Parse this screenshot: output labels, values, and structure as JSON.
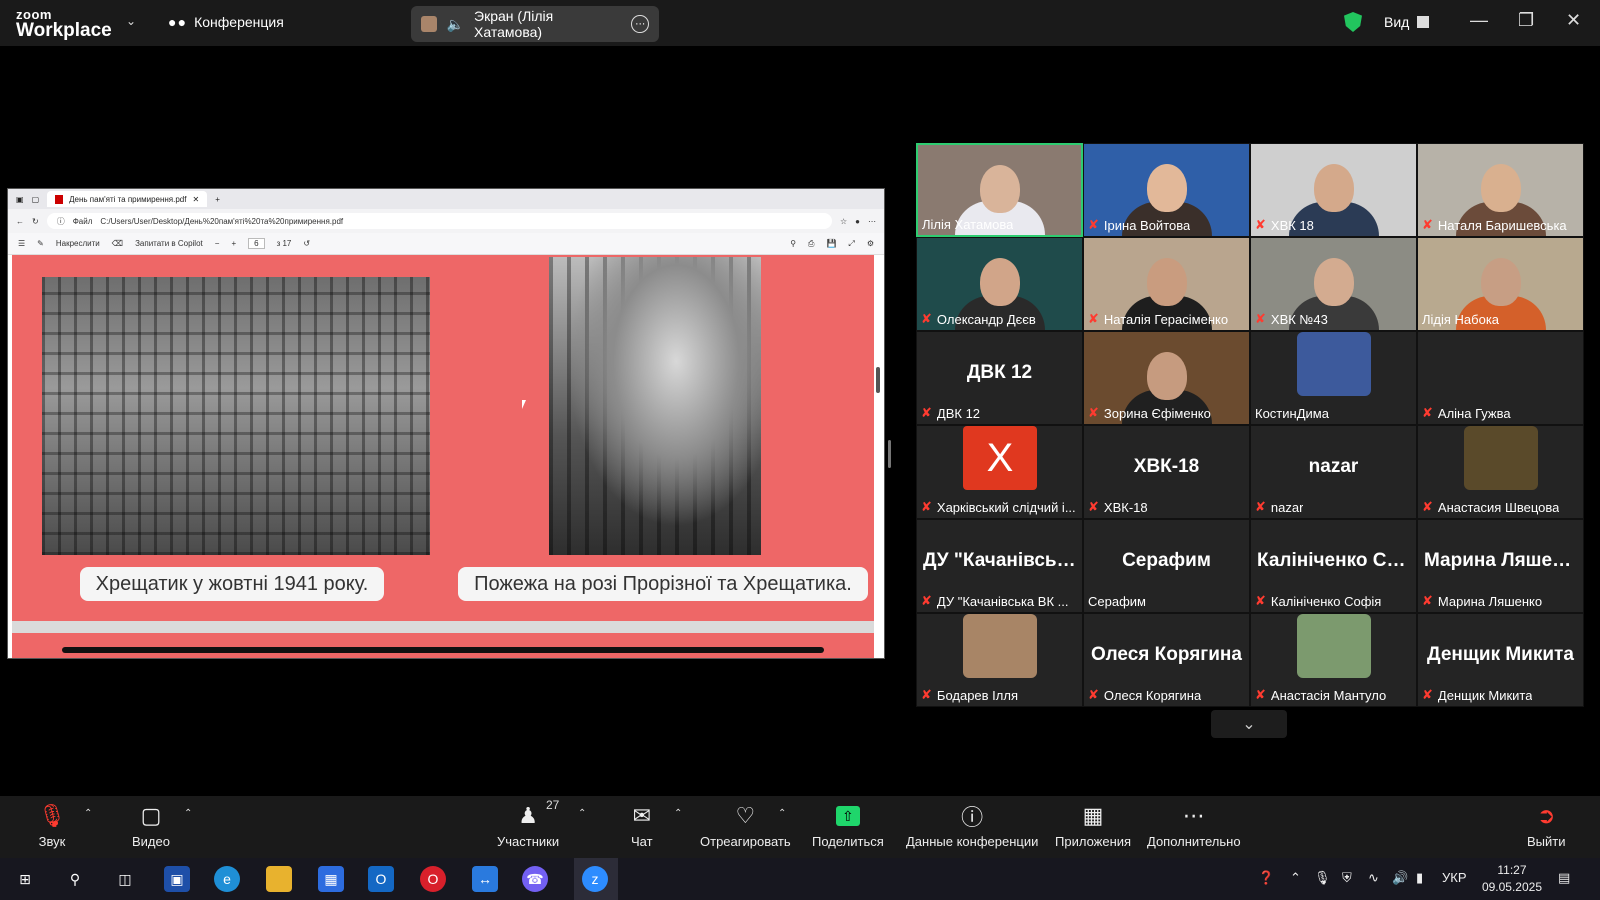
{
  "topbar": {
    "logo_line1": "zoom",
    "logo_line2": "Workplace",
    "meeting_label": "Конференция",
    "screen_share_label": "Экран (Лілія Хатамова)",
    "view_label": "Вид"
  },
  "browser": {
    "tab_title": "День пам'яті та примирення.pdf",
    "addr_prefix": "Файл",
    "url": "C:/Users/User/Desktop/День%20пам'яті%20та%20примирення.pdf",
    "draw_label": "Накреслити",
    "copilot_label": "Запитати в Copilot",
    "page_num": "6",
    "page_total": "з 17"
  },
  "pdf": {
    "caption_left": "Хрещатик у жовтні 1941 року.",
    "caption_right": "Пожежа на розі Прорізної та Хрещатика."
  },
  "participants": [
    {
      "name": "Лілія Хатамова",
      "big": "",
      "type": "video",
      "muted": false,
      "speaking": true,
      "skin": "#d9b49a",
      "bg": "#8a7a70",
      "shirt": "#e9e9ef"
    },
    {
      "name": "Ірина Войтова",
      "big": "",
      "type": "video",
      "muted": true,
      "skin": "#e2b899",
      "bg": "#2f5fa8",
      "shirt": "#3a2f2a"
    },
    {
      "name": "ХВК 18",
      "big": "",
      "type": "video",
      "muted": true,
      "skin": "#d4a98b",
      "bg": "#cfcfcf",
      "shirt": "#2b3b55"
    },
    {
      "name": "Наталя Баришевська",
      "big": "",
      "type": "video",
      "muted": true,
      "skin": "#d9b08f",
      "bg": "#b7b2a8",
      "shirt": "#6b4b3a"
    },
    {
      "name": "Олександр Дєєв",
      "big": "",
      "type": "video",
      "muted": true,
      "skin": "#d1a589",
      "bg": "#1f4b4b",
      "shirt": "#2a2a2a"
    },
    {
      "name": "Наталія Герасіменко",
      "big": "",
      "type": "video",
      "muted": true,
      "skin": "#c99c7f",
      "bg": "#b9a58e",
      "shirt": "#1e1e1e"
    },
    {
      "name": "ХВК №43",
      "big": "",
      "type": "video",
      "muted": true,
      "skin": "#d3ab90",
      "bg": "#8c8c84",
      "shirt": "#3a3a3a"
    },
    {
      "name": "Лідія Набока",
      "big": "",
      "type": "video",
      "muted": false,
      "skin": "#c79e84",
      "bg": "#b8a98f",
      "shirt": "#d4602a"
    },
    {
      "name": "ДВК 12",
      "big": "ДВК 12",
      "type": "text",
      "muted": true
    },
    {
      "name": "Зорина  Єфіменко",
      "big": "",
      "type": "video",
      "muted": true,
      "skin": "#c69b7f",
      "bg": "#6b4b2f",
      "shirt": "#202020"
    },
    {
      "name": "КостинДима",
      "big": "",
      "type": "picture",
      "muted": false,
      "pic": "#3d5a9c"
    },
    {
      "name": "Аліна Гужва",
      "big": "",
      "type": "empty",
      "muted": true
    },
    {
      "name": "Харківський слідчий і...",
      "big": "X",
      "type": "x-avatar",
      "muted": true
    },
    {
      "name": "ХВК-18",
      "big": "ХВК-18",
      "type": "text",
      "muted": true
    },
    {
      "name": "nazar",
      "big": "nazar",
      "type": "text",
      "muted": true
    },
    {
      "name": "Анастасия Швецова",
      "big": "",
      "type": "picture",
      "muted": true,
      "pic": "#5a4a2a"
    },
    {
      "name": "ДУ \"Качанівська ВК ...",
      "big": "ДУ \"Качанівськ...",
      "type": "text",
      "muted": true
    },
    {
      "name": "Серафим",
      "big": "Серафим",
      "type": "text",
      "muted": false
    },
    {
      "name": "Калініченко Софія",
      "big": "Калініченко Со...",
      "type": "text",
      "muted": true
    },
    {
      "name": "Марина Ляшенко",
      "big": "Марина Ляшен...",
      "type": "text",
      "muted": true
    },
    {
      "name": "Бодарев Ілля",
      "big": "",
      "type": "picture",
      "muted": true,
      "pic": "#a88566"
    },
    {
      "name": "Олеся Корягина",
      "big": "Олеся Корягина",
      "type": "text",
      "muted": true
    },
    {
      "name": "Анастасія Мантуло",
      "big": "",
      "type": "picture",
      "muted": true,
      "pic": "#7c9a6e"
    },
    {
      "name": "Денщик Микита",
      "big": "Денщик Микита",
      "type": "text",
      "muted": true
    }
  ],
  "toolbar": {
    "audio": "Звук",
    "video": "Видео",
    "participants": "Участники",
    "participants_count": "27",
    "chat": "Чат",
    "react": "Отреагировать",
    "share": "Поделиться",
    "info": "Данные конференции",
    "apps": "Приложения",
    "more": "Дополнительно",
    "leave": "Выйти"
  },
  "taskbar": {
    "lang": "УКР",
    "time": "11:27",
    "date": "09.05.2025"
  }
}
